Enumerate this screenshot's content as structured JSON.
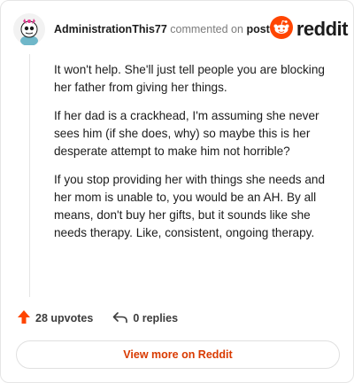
{
  "header": {
    "username": "AdministrationThis77",
    "commented_text": "commented on",
    "post_link": "post",
    "logo_text": "reddit"
  },
  "comment": {
    "paragraphs": [
      "It won't help. She'll just tell people you are blocking her father from giving her things.",
      "If her dad is a crackhead, I'm assuming she never sees him (if she does, why) so maybe this is her desperate attempt to make him not horrible?",
      "If you stop providing her with things she needs and her mom is unable to, you would be an AH. By all means, don't buy her gifts, but it sounds like she needs therapy. Like, consistent, ongoing therapy."
    ]
  },
  "actions": {
    "upvotes": "28 upvotes",
    "replies": "0 replies"
  },
  "view_more": "View more on Reddit",
  "colors": {
    "brand": "#ff4500",
    "link": "#d93a00",
    "upvote": "#ff4500"
  },
  "icons": [
    "avatar",
    "reddit-logo-icon",
    "upvote-arrow-icon",
    "reply-arrow-icon"
  ]
}
